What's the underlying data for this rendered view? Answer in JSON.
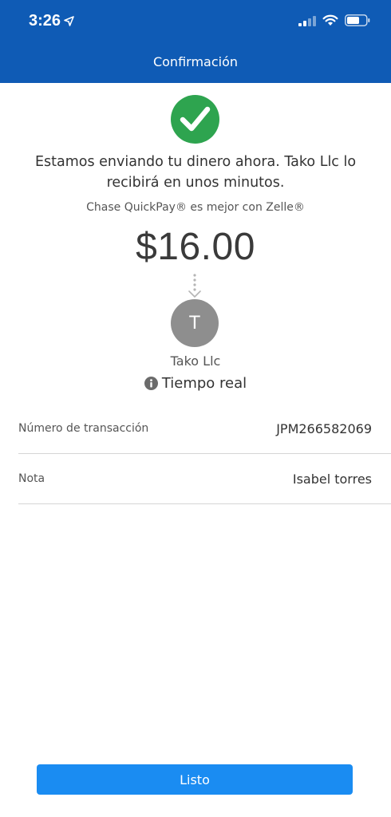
{
  "status_bar": {
    "time": "3:26",
    "icons": [
      "location-arrow-icon",
      "signal-icon",
      "wifi-icon",
      "battery-icon"
    ]
  },
  "header": {
    "title": "Confirmación",
    "background_color": "#0f5bb5"
  },
  "confirmation": {
    "icon": "checkmark-circle-icon",
    "icon_color": "#2ea44f",
    "message": "Estamos enviando tu dinero ahora. Tako Llc  lo recibirá en unos minutos.",
    "subline": "Chase QuickPay® es mejor con Zelle®",
    "amount": "$16.00"
  },
  "recipient": {
    "initial": "T",
    "name": "Tako Llc",
    "delivery_icon": "info-icon",
    "delivery_speed": "Tiempo real"
  },
  "details": [
    {
      "label": "Número de transacción",
      "value": "JPM266582069"
    },
    {
      "label": "Nota",
      "value": "Isabel torres"
    }
  ],
  "actions": {
    "done_label": "Listo",
    "button_color": "#1a8cf2"
  }
}
